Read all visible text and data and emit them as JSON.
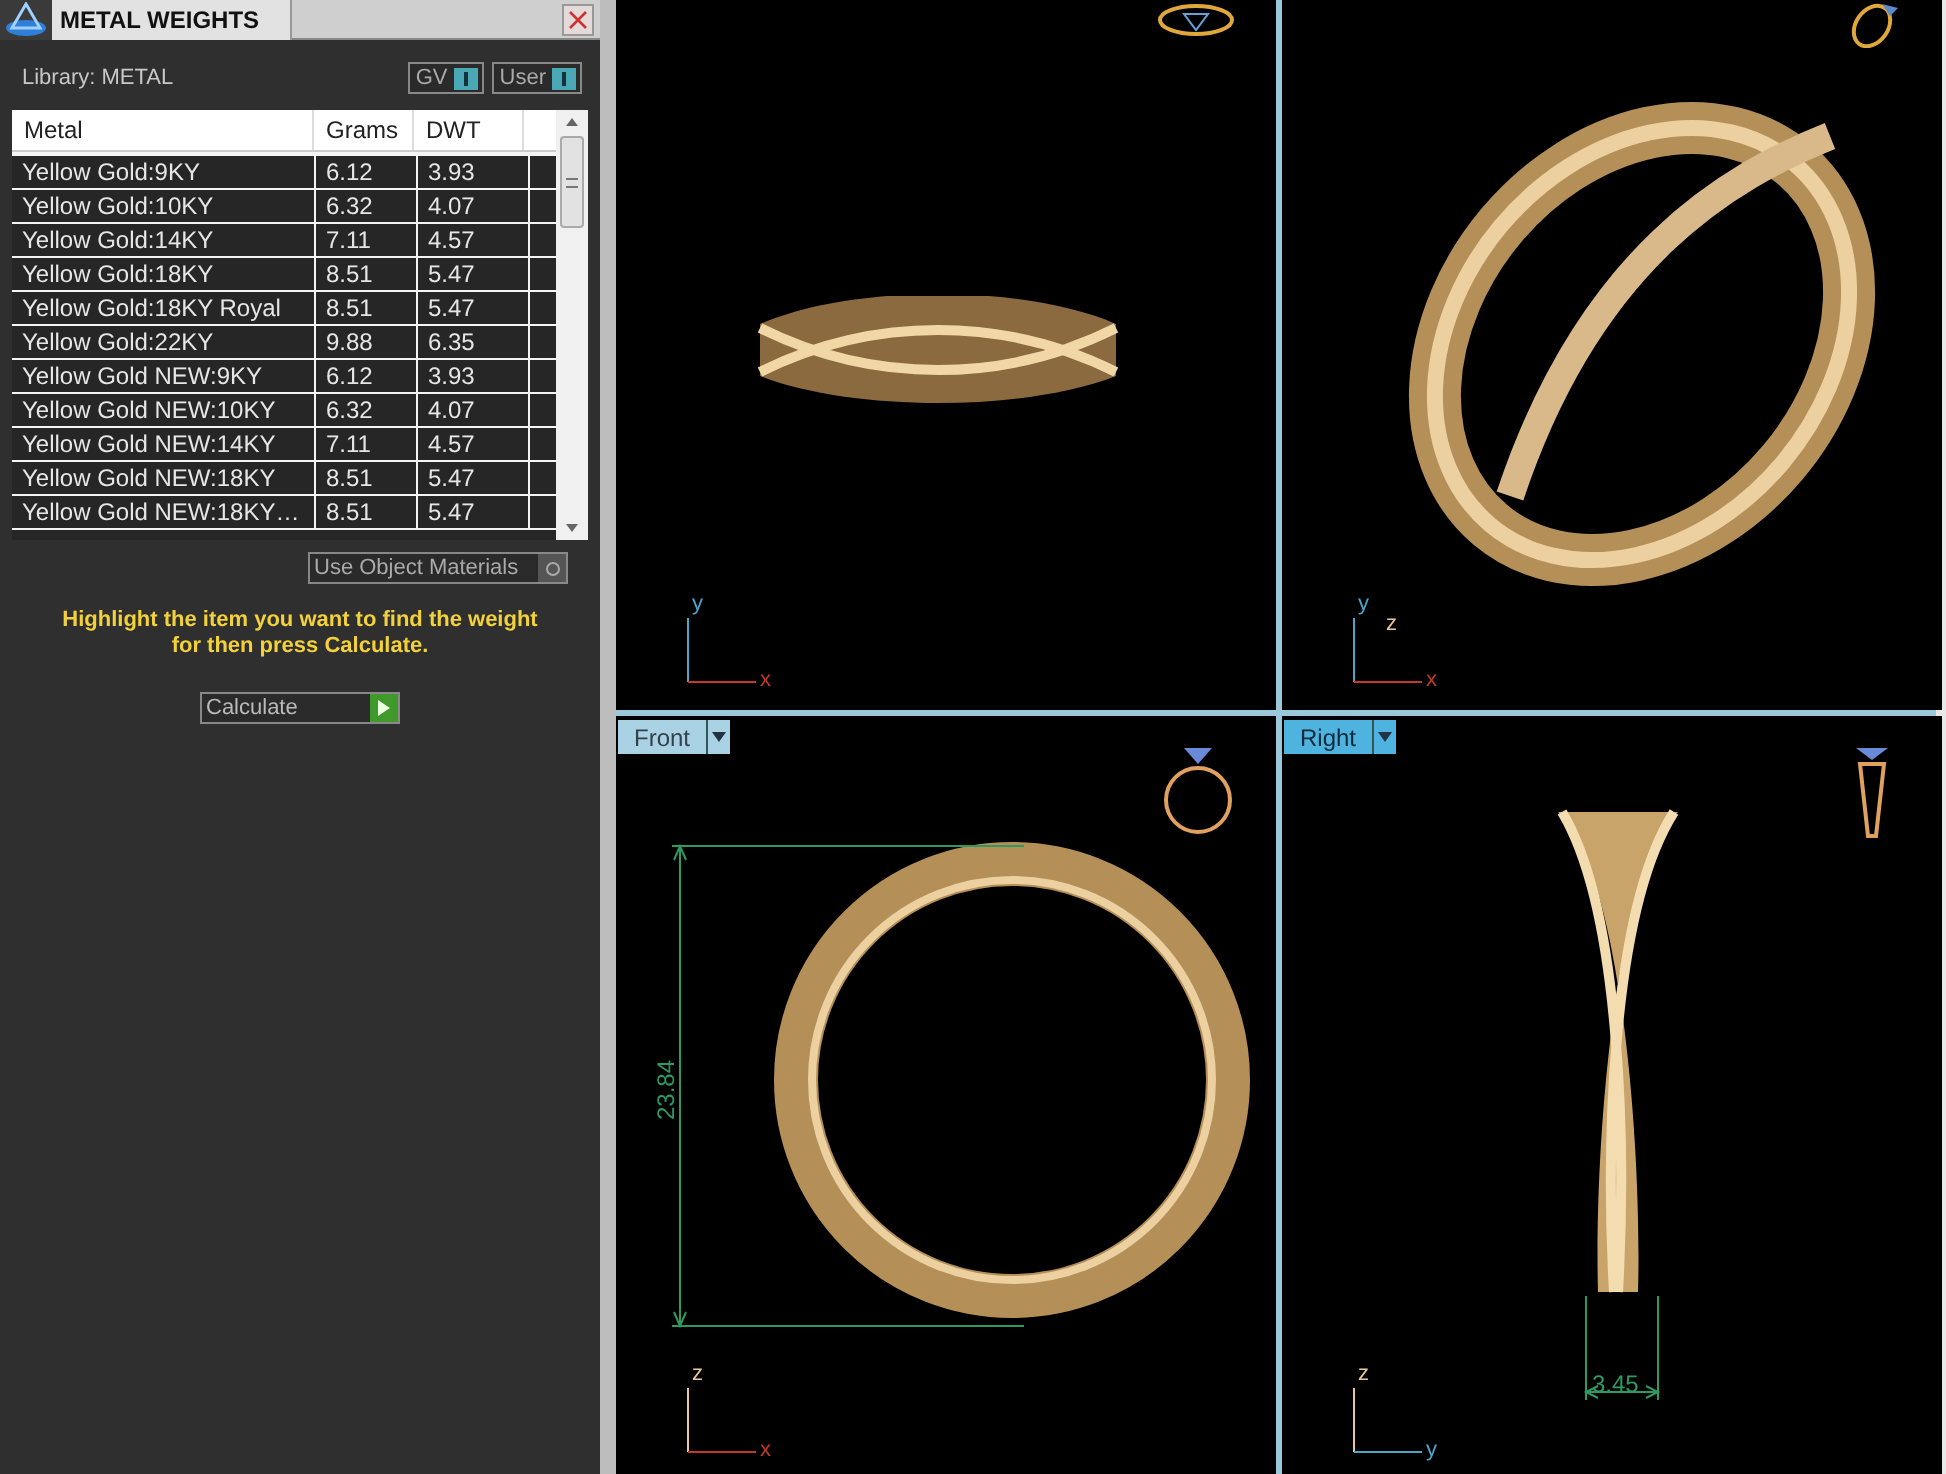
{
  "panel": {
    "title": "METAL WEIGHTS",
    "library": "Library: METAL",
    "toggles": [
      {
        "label": "GV",
        "on": true
      },
      {
        "label": "User",
        "on": true
      }
    ],
    "table": {
      "columns": [
        "Metal",
        "Grams",
        "DWT"
      ],
      "rows": [
        {
          "metal": "Yellow Gold:9KY",
          "grams": "6.12",
          "dwt": "3.93"
        },
        {
          "metal": "Yellow Gold:10KY",
          "grams": "6.32",
          "dwt": "4.07"
        },
        {
          "metal": "Yellow Gold:14KY",
          "grams": "7.11",
          "dwt": "4.57"
        },
        {
          "metal": "Yellow Gold:18KY",
          "grams": "8.51",
          "dwt": "5.47"
        },
        {
          "metal": "Yellow Gold:18KY Royal",
          "grams": "8.51",
          "dwt": "5.47"
        },
        {
          "metal": "Yellow Gold:22KY",
          "grams": "9.88",
          "dwt": "6.35"
        },
        {
          "metal": "Yellow Gold NEW:9KY",
          "grams": "6.12",
          "dwt": "3.93"
        },
        {
          "metal": "Yellow Gold NEW:10KY",
          "grams": "6.32",
          "dwt": "4.07"
        },
        {
          "metal": "Yellow Gold NEW:14KY",
          "grams": "7.11",
          "dwt": "4.57"
        },
        {
          "metal": "Yellow Gold NEW:18KY",
          "grams": "8.51",
          "dwt": "5.47"
        },
        {
          "metal": "Yellow Gold NEW:18KY…",
          "grams": "8.51",
          "dwt": "5.47"
        }
      ]
    },
    "use_object_materials": {
      "label": "Use Object Materials",
      "on": false
    },
    "hint": "Highlight the item you want to find the weight for then press Calculate.",
    "calculate": "Calculate"
  },
  "viewports": [
    {
      "kind": "top",
      "axes": [
        "y",
        "x"
      ]
    },
    {
      "kind": "perspective",
      "axes": [
        "y",
        "z",
        "x"
      ]
    },
    {
      "kind": "front",
      "label": "Front",
      "selected": false,
      "axes": [
        "z",
        "x"
      ],
      "dimension": "23.84"
    },
    {
      "kind": "right",
      "label": "Right",
      "selected": true,
      "axes": [
        "z",
        "y"
      ],
      "dimension": "3.45"
    }
  ]
}
